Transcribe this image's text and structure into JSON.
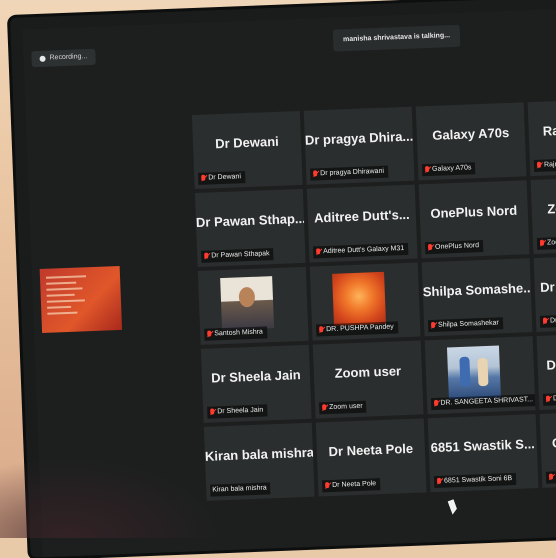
{
  "recording_label": "Recording...",
  "talking_label": "manisha shrivastava is talking...",
  "tiles": [
    {
      "name": "Dr Dewani",
      "tag": "Dr Dewani"
    },
    {
      "name": "Dr pragya Dhira...",
      "tag": "Dr pragya Dhirawani"
    },
    {
      "name": "Galaxy A70s",
      "tag": "Galaxy A70s"
    },
    {
      "name": "Rajni",
      "tag": "Rajni Khatr"
    },
    {
      "name": "Dr Pawan Sthap...",
      "tag": "Dr Pawan Sthapak"
    },
    {
      "name": "Aditree Dutt's...",
      "tag": "Aditree Dutt's Galaxy M31"
    },
    {
      "name": "OnePlus Nord",
      "tag": "OnePlus Nord"
    },
    {
      "name": "Zoor",
      "tag": "Zoom user"
    },
    {
      "name": "",
      "tag": "Santosh Mishra",
      "photo": "p-santosh"
    },
    {
      "name": "",
      "tag": "DR. PUSHPA Pandey",
      "photo": "p-pushpa"
    },
    {
      "name": "Shilpa Somashe...",
      "tag": "Shilpa Somashekar"
    },
    {
      "name": "Dr Shas",
      "tag": "Dr Shashi"
    },
    {
      "name": "Dr Sheela Jain",
      "tag": "Dr Sheela Jain"
    },
    {
      "name": "Zoom user",
      "tag": "Zoom user"
    },
    {
      "name": "",
      "tag": "DR. SANGEETA SHRIVAST...",
      "photo": "p-sangeeta"
    },
    {
      "name": "Dr Poo",
      "tag": "Dr Pooja W"
    },
    {
      "name": "Kiran bala mishra",
      "tag": "Kiran bala mishra",
      "nomic": true
    },
    {
      "name": "Dr Neeta Pole",
      "tag": "Dr Neeta Pole"
    },
    {
      "name": "6851 Swastik S...",
      "tag": "6851 Swastik Soni 6B"
    },
    {
      "name": "OnePl",
      "tag": "OnePlus"
    }
  ],
  "icons": {
    "mic": "mic-muted-icon",
    "record": "record-icon",
    "cursor": "mouse-pointer-icon"
  }
}
